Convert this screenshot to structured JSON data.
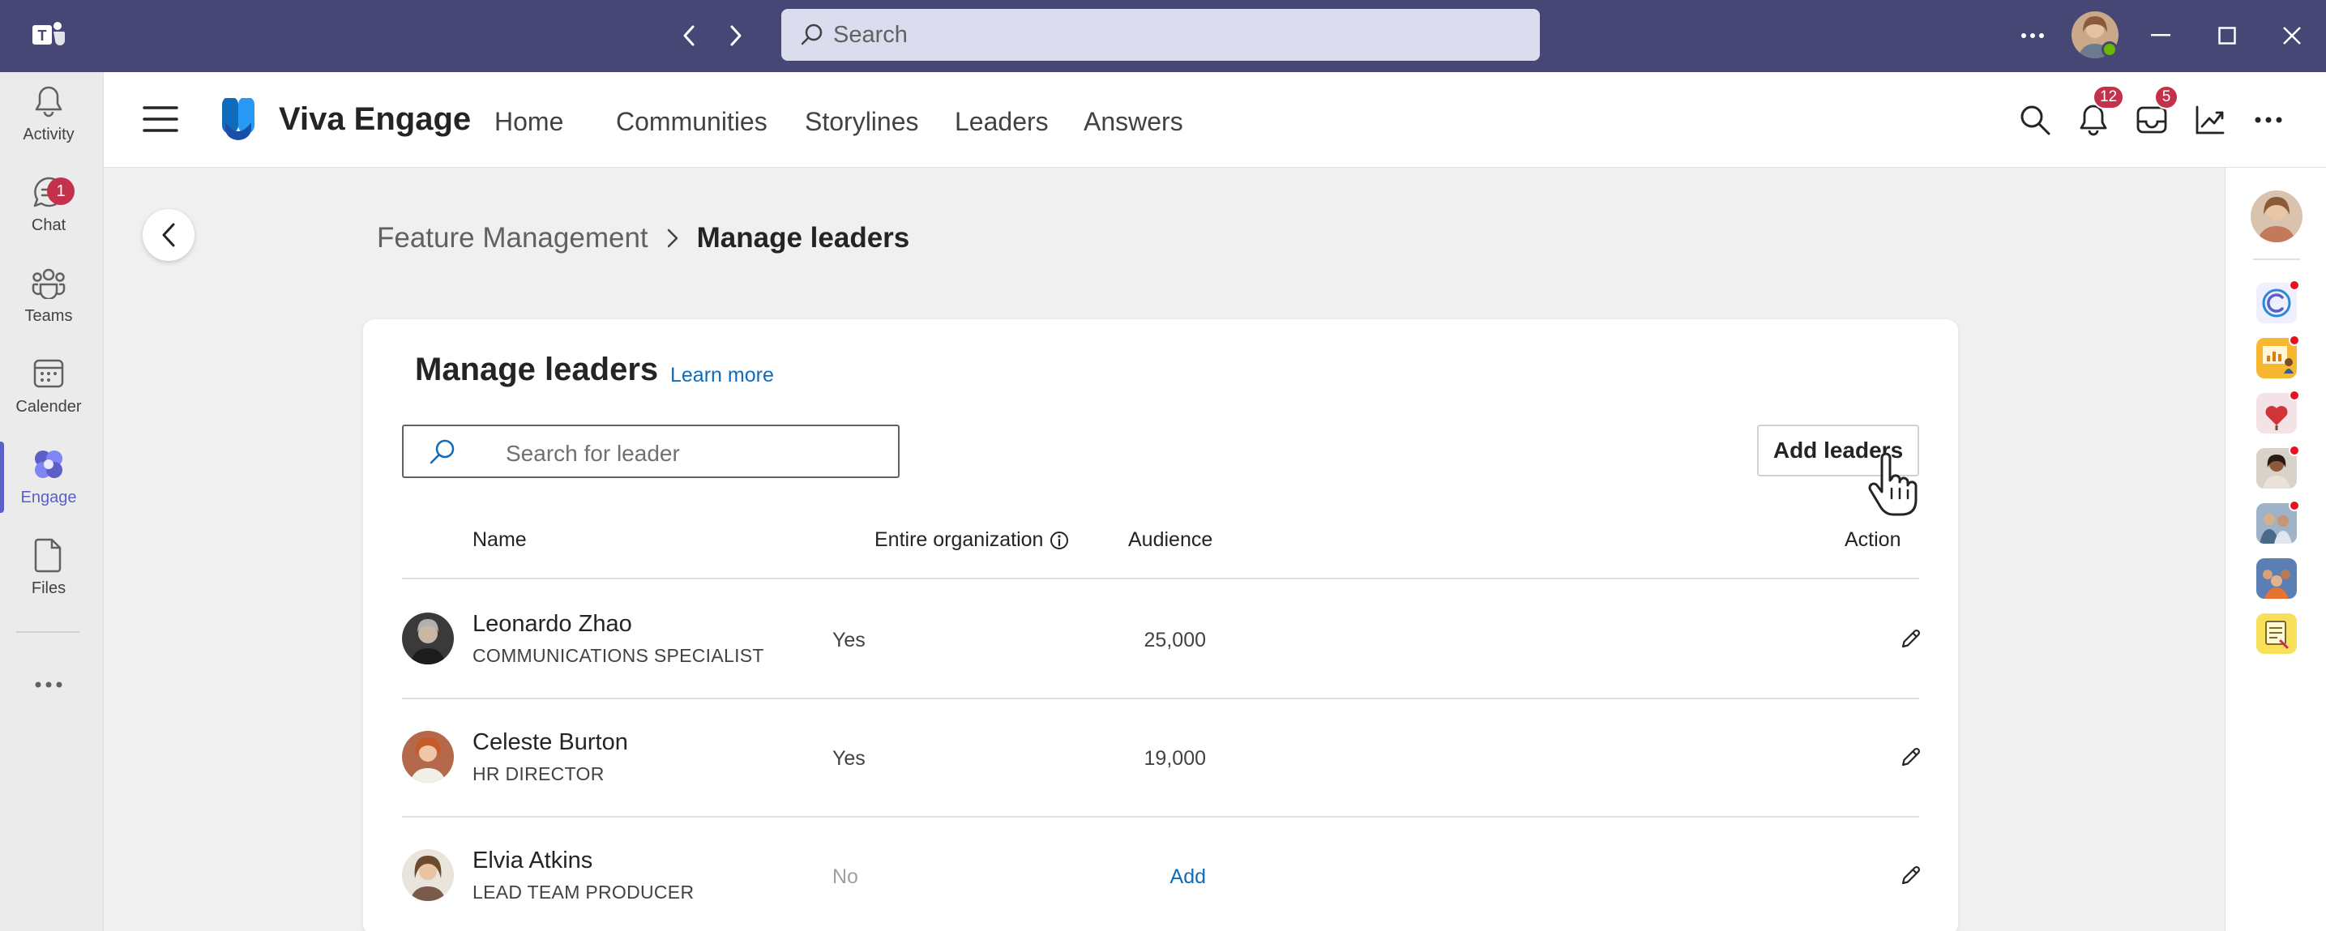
{
  "titlebar": {
    "search_placeholder": "Search"
  },
  "left_rail": {
    "items": [
      {
        "label": "Activity",
        "icon": "bell-icon"
      },
      {
        "label": "Chat",
        "icon": "chat-icon",
        "badge": "1"
      },
      {
        "label": "Teams",
        "icon": "teams-icon"
      },
      {
        "label": "Calender",
        "icon": "calendar-icon"
      },
      {
        "label": "Engage",
        "icon": "engage-icon",
        "active": true
      },
      {
        "label": "Files",
        "icon": "file-icon"
      }
    ]
  },
  "header": {
    "brand": "Viva Engage",
    "nav": [
      "Home",
      "Communities",
      "Storylines",
      "Leaders",
      "Answers"
    ],
    "notifications_badge": "12",
    "inbox_badge": "5"
  },
  "breadcrumb": {
    "parent": "Feature Management",
    "current": "Manage leaders"
  },
  "card": {
    "title": "Manage leaders",
    "learn_more": "Learn more",
    "search_placeholder": "Search for leader",
    "add_button": "Add leaders",
    "columns": {
      "name": "Name",
      "org": "Entire organization",
      "audience": "Audience",
      "action": "Action"
    },
    "rows": [
      {
        "name": "Leonardo Zhao",
        "title": "COMMUNICATIONS SPECIALIST",
        "org": "Yes",
        "audience": "25,000"
      },
      {
        "name": "Celeste Burton",
        "title": "HR DIRECTOR",
        "org": "Yes",
        "audience": "19,000"
      },
      {
        "name": "Elvia Atkins",
        "title": "LEAD TEAM PRODUCER",
        "org": "No",
        "audience": "Add"
      }
    ]
  },
  "colors": {
    "titlebar": "#464775",
    "accent": "#5b5fc7",
    "link": "#0f6cbd",
    "badge": "#c4314b"
  }
}
